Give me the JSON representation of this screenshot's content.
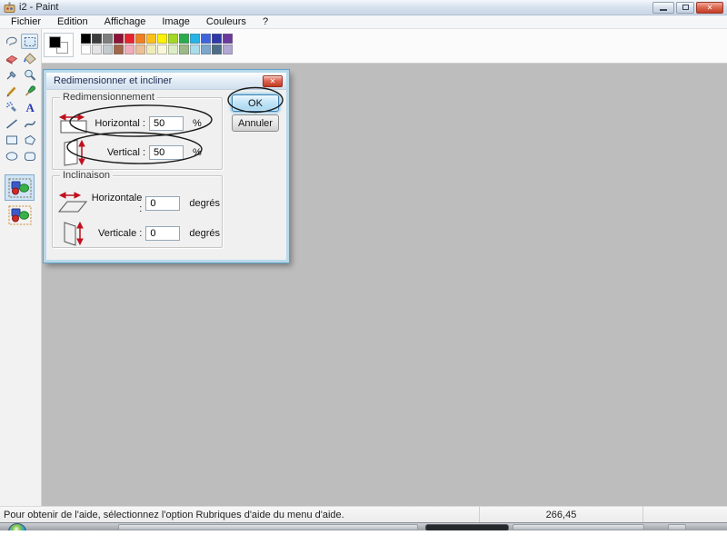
{
  "window": {
    "title": "i2 - Paint",
    "icons": {
      "close": "✕"
    }
  },
  "menu": {
    "items": [
      "Fichier",
      "Edition",
      "Affichage",
      "Image",
      "Couleurs",
      "?"
    ]
  },
  "palette": {
    "foreground": "#000000",
    "background": "#ffffff",
    "row1": [
      "#000000",
      "#3c3c3c",
      "#7e7e7e",
      "#8e1236",
      "#e6232e",
      "#f08021",
      "#fcc018",
      "#fdf104",
      "#a2d824",
      "#2cab4d",
      "#26b3e8",
      "#3f64dc",
      "#2e38a8",
      "#6a3a9c"
    ],
    "row2": [
      "#fefefe",
      "#e4e4e4",
      "#c2cacd",
      "#a2664c",
      "#f2abb9",
      "#ecc096",
      "#f0ecb8",
      "#f8f6d8",
      "#dcedc4",
      "#9cb989",
      "#abdcec",
      "#7ca6cc",
      "#4e6c86",
      "#b2a6d2"
    ]
  },
  "tools": {
    "items": [
      "free-form-select",
      "select",
      "eraser",
      "fill",
      "color-picker",
      "magnifier",
      "pencil",
      "brush",
      "airbrush",
      "text",
      "line",
      "curve",
      "rectangle",
      "polygon",
      "ellipse",
      "rounded-rectangle"
    ],
    "selected": "select",
    "selected_option": "selection-opaque"
  },
  "dialog": {
    "title": "Redimensionner et incliner",
    "resize": {
      "label": "Redimensionnement",
      "h_label": "Horizontal :",
      "h_value": "50",
      "h_unit": "%",
      "v_label": "Vertical :",
      "v_value": "50",
      "v_unit": "%"
    },
    "skew": {
      "label": "Inclinaison",
      "h_label": "Horizontale :",
      "h_value": "0",
      "h_unit": "degrés",
      "v_label": "Verticale :",
      "v_value": "0",
      "v_unit": "degrés"
    },
    "buttons": {
      "ok": "OK",
      "cancel": "Annuler"
    }
  },
  "status": {
    "help_text": "Pour obtenir de l'aide, sélectionnez l'option Rubriques d'aide du menu d'aide.",
    "coordinates": "266,45"
  }
}
